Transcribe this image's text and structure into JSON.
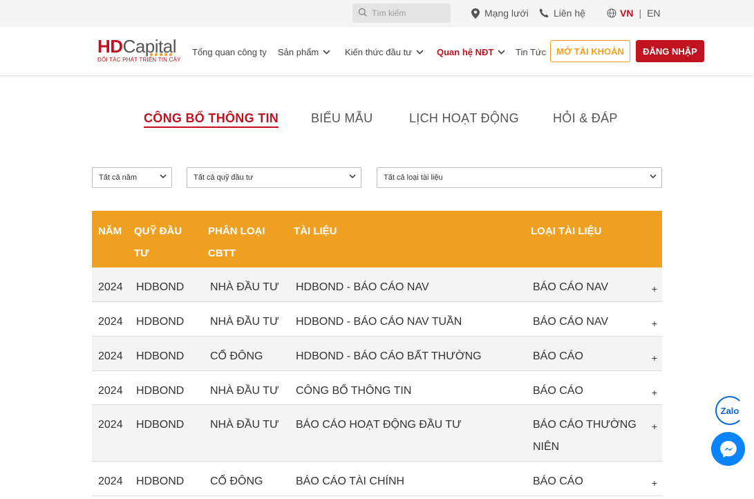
{
  "topbar": {
    "search_placeholder": "Tìm kiếm",
    "network": "Mạng lưới",
    "contact": "Liên hệ",
    "lang_vn": "VN",
    "lang_sep": "|",
    "lang_en": "EN"
  },
  "header": {
    "logo_hd": "HD",
    "logo_capital": "Capital",
    "logo_tagline": "ĐỐI TÁC PHÁT TRIỂN TIN CẬY",
    "nav": [
      {
        "label": "Tổng quan công ty"
      },
      {
        "label": "Sản phẩm"
      },
      {
        "label": "Kiến thức đầu tư"
      },
      {
        "label": "Quan hệ NĐT"
      },
      {
        "label": "Tin Tức"
      }
    ],
    "open_account": "MỞ TÀI KHOẢN",
    "login": "ĐĂNG NHẬP"
  },
  "tabs": [
    {
      "label": "CÔNG BỐ THÔNG TIN"
    },
    {
      "label": "BIỂU MẪU"
    },
    {
      "label": "LỊCH HOẠT ĐỘNG"
    },
    {
      "label": "HỎI & ĐÁP"
    }
  ],
  "filters": {
    "year": "Tất cả năm",
    "fund": "Tất cả quỹ đầu tư",
    "doctype": "Tất cả loại tài liệu"
  },
  "table": {
    "headers": {
      "year": "NĂM",
      "fund_1": "QUỸ ĐẦU",
      "fund_2": "TƯ",
      "category_1": "PHÂN LOẠI",
      "category_2": "CBTT",
      "document": "TÀI LIỆU",
      "doctype": "LOẠI TÀI LIỆU"
    },
    "expand_symbol": "+",
    "rows": [
      {
        "year": "2024",
        "fund": "HDBOND",
        "category": "NHÀ ĐẦU TƯ",
        "document": "HDBOND - BÁO CÁO NAV",
        "type_1": "BÁO CÁO NAV",
        "type_2": ""
      },
      {
        "year": "2024",
        "fund": "HDBOND",
        "category": "NHÀ ĐẦU TƯ",
        "document": "HDBOND - BÁO CÁO NAV TUẦN",
        "type_1": "BÁO CÁO NAV",
        "type_2": ""
      },
      {
        "year": "2024",
        "fund": "HDBOND",
        "category": "CỔ ĐÔNG",
        "document": "HDBOND - BÁO CÁO BẤT THƯỜNG",
        "type_1": "BÁO CÁO",
        "type_2": ""
      },
      {
        "year": "2024",
        "fund": "HDBOND",
        "category": "NHÀ ĐẦU TƯ",
        "document": "CÔNG BỐ THÔNG TIN",
        "type_1": "BÁO CÁO",
        "type_2": ""
      },
      {
        "year": "2024",
        "fund": "HDBOND",
        "category": "NHÀ ĐẦU TƯ",
        "document": "BÁO CÁO HOẠT ĐỘNG ĐẦU TƯ",
        "type_1": "BÁO CÁO THƯỜNG",
        "type_2": "NIÊN"
      },
      {
        "year": "2024",
        "fund": "HDBOND",
        "category": "CỔ ĐÔNG",
        "document": "BÁO CÁO TÀI CHÍNH",
        "type_1": "BÁO CÁO",
        "type_2": ""
      }
    ]
  },
  "floating": {
    "zalo": "Zalo"
  },
  "colors": {
    "brand_red": "#c1121f",
    "accent_orange": "#f0a020",
    "messenger_blue": "#0a84ff"
  }
}
